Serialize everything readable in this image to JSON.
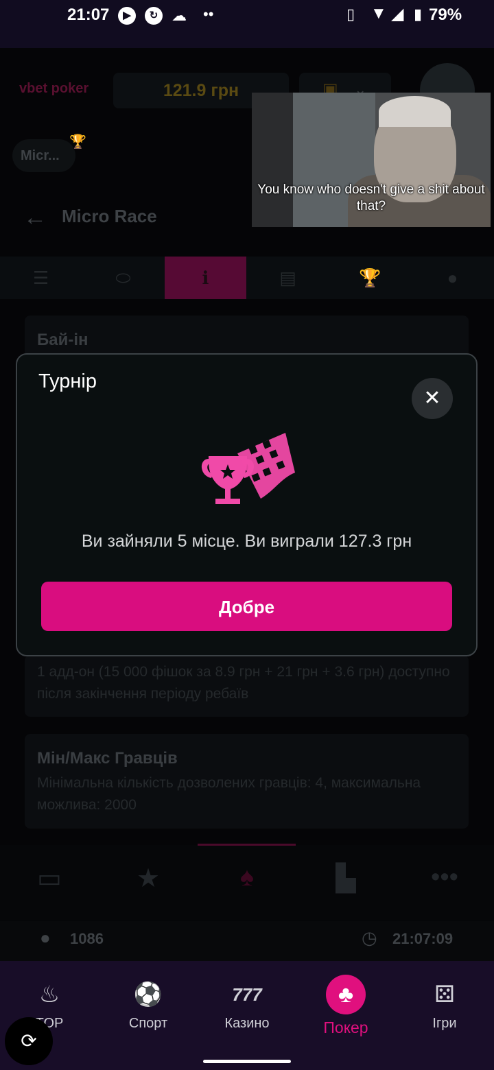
{
  "status_bar": {
    "time": "21:07",
    "battery": "79%"
  },
  "header": {
    "logo": "vbet poker",
    "balance": "121.9 грн",
    "chip_label": "Micr..."
  },
  "page": {
    "title": "Micro Race"
  },
  "cards": [
    {
      "title": "Бай-ін"
    },
    {
      "text": "1 адд-он (15 000 фішок за 8.9 грн + 21 грн + 3.6 грн) доступно після закінчення періоду ребаїв"
    },
    {
      "title": "Мін/Макс Гравців",
      "text": "Мінімальна кількість дозволених гравців: 4, максимальна можлива: 2000"
    }
  ],
  "info_row": {
    "players": "1086",
    "clock": "21:07:09"
  },
  "bottom_nav": [
    {
      "label": "TOP",
      "icon": "flame-icon"
    },
    {
      "label": "Спорт",
      "icon": "soccer-ball-icon"
    },
    {
      "label": "Казино",
      "icon": "slots-777-icon"
    },
    {
      "label": "Покер",
      "icon": "club-icon"
    },
    {
      "label": "Ігри",
      "icon": "dice-icon"
    }
  ],
  "video": {
    "caption": "You know who doesn't give a shit about that?"
  },
  "modal": {
    "title": "Турнір",
    "message": "Ви зайняли 5 місце. Ви виграли 127.3 грн",
    "ok_label": "Добре",
    "accent": "#d90d7f"
  }
}
